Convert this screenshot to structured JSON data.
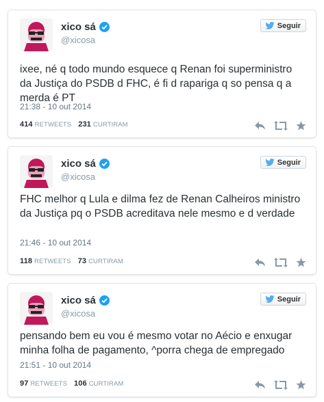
{
  "follow_label": "Seguir",
  "colors": {
    "accent": "#55acee",
    "verified": "#1da1f2",
    "icon_gray": "#8899a6"
  },
  "tweets": [
    {
      "name": "xico sá",
      "handle": "@xicosa",
      "text": "ixee, né q todo mundo esquece q Renan foi superministro da Justiça do PSDB d FHC, é fi d rapariga q so pensa q a merda é PT",
      "time": "21:38 - 10 out 2014",
      "retweets": "414",
      "retweets_label": "RETWEETS",
      "likes": "231",
      "likes_label": "CURTIRAM"
    },
    {
      "name": "xico sá",
      "handle": "@xicosa",
      "text": "FHC melhor q Lula e dilma fez de Renan Calheiros ministro da Justiça pq o PSDB acreditava nele mesmo e d verdade",
      "time": "21:46 - 10 out 2014",
      "retweets": "118",
      "retweets_label": "RETWEETS",
      "likes": "73",
      "likes_label": "CURTIRAM"
    },
    {
      "name": "xico sá",
      "handle": "@xicosa",
      "text": "pensando bem eu vou é mesmo votar no Aécio e enxugar minha folha de pagamento, ^porra chega de empregado",
      "time": "21:51 - 10 out 2014",
      "retweets": "97",
      "retweets_label": "RETWEETS",
      "likes": "106",
      "likes_label": "CURTIRAM"
    }
  ]
}
